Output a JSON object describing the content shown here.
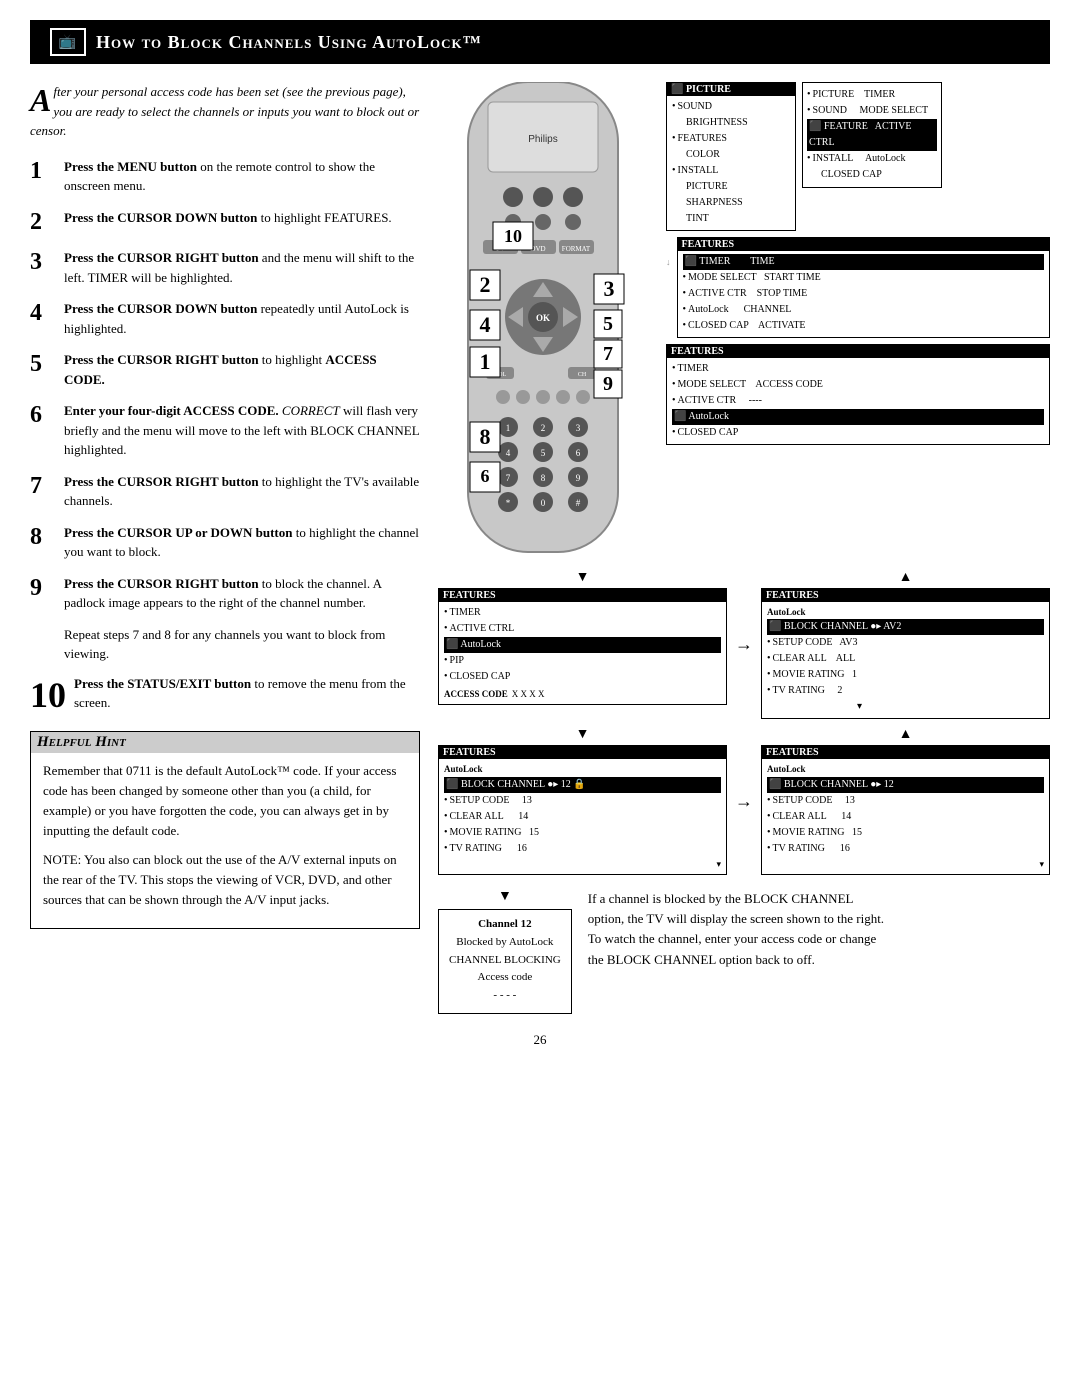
{
  "header": {
    "title": "How to Block Channels Using AutoLock™",
    "icon": "📺"
  },
  "intro": {
    "drop_cap": "A",
    "text": "fter your personal access code has been set (see the previous page), you are ready to select the channels or inputs you want to block out or censor."
  },
  "steps": [
    {
      "num": "1",
      "large": false,
      "html": "<b>Press the MENU button</b> on the remote control to show the onscreen menu."
    },
    {
      "num": "2",
      "large": false,
      "html": "<b>Press the CURSOR DOWN button</b> to highlight FEATURES."
    },
    {
      "num": "3",
      "large": false,
      "html": "<b>Press the CURSOR RIGHT button</b> and the menu will shift to the left. TIMER will be highlighted."
    },
    {
      "num": "4",
      "large": false,
      "html": "<b>Press the CURSOR DOWN button</b> repeatedly until AutoLock is highlighted."
    },
    {
      "num": "5",
      "large": false,
      "html": "<b>Press the CURSOR RIGHT button</b> to highlight <b>ACCESS CODE.</b>"
    },
    {
      "num": "6",
      "large": false,
      "html": "<b>Enter your four-digit ACCESS CODE.</b> <i>CORRECT</i> will flash very briefly and the menu will move to the left with BLOCK CHANNEL highlighted."
    },
    {
      "num": "7",
      "large": false,
      "html": "<b>Press the CURSOR RIGHT button</b> to highlight the TV's available channels."
    },
    {
      "num": "8",
      "large": false,
      "html": "<b>Press the CURSOR UP or DOWN button</b> to highlight the channel you want to block."
    },
    {
      "num": "9",
      "large": false,
      "html": "<b>Press the CURSOR RIGHT button</b> to block the channel. A padlock image appears to the right of the channel number."
    }
  ],
  "repeat_note": "Repeat steps 7 and 8 for any channels you want to block from viewing.",
  "step10": {
    "num": "10",
    "html": "<b>Press the STATUS/EXIT button</b> to remove the menu from the screen."
  },
  "helpful_hint": {
    "title": "Helpful Hint",
    "body1": "Remember that 0711 is the default AutoLock™ code. If your access code has been changed by someone other than you (a child, for example) or you have forgotten the code, you can always get in by inputting the default code.",
    "body2": "NOTE: You also can block out the use of the A/V external inputs on the rear of the TV. This stops the viewing of VCR, DVD, and other sources that can be shown through the A/V input jacks."
  },
  "menu_panels": {
    "panel1_title": "PICTURE",
    "panel1_items": [
      "BRIGHTNESS",
      "COLOR",
      "PICTURE",
      "SHARPNESS",
      "TINT"
    ],
    "panel1_selected": "PICTURE",
    "panel2_title": "",
    "panel2_items": [
      "PICTURE",
      "SOUND",
      "FEATURE",
      "INSTALL"
    ],
    "panel2_right": [
      "TIMER",
      "MODE SELECT",
      "ACTIVE CTRL",
      "AutoLock",
      "CLOSED CAP"
    ],
    "panel2_selected": "FEATURE",
    "panel3_title": "FEATURES",
    "panel3_items": [
      "TIMER",
      "MODE SELECT",
      "ACTIVE CTR",
      "AutoLock",
      "CLOSED CAP"
    ],
    "panel3_right": [
      "TIME",
      "START TIME",
      "STOP TIME",
      "CHANNEL",
      "ACTIVATE"
    ],
    "panel3_selected": "TIMER",
    "panel4_title": "FEATURES",
    "panel4_items": [
      "TIMER",
      "MODE SELECT",
      "ACTIVE CTR",
      "AutoLock",
      "CLOSED CAP"
    ],
    "panel4_access": "ACCESS CODE",
    "panel4_access_val": "----",
    "panel4_selected": "AutoLock",
    "panel5_title": "FEATURES",
    "panel5_items": [
      "TIMER",
      "ACTIVE CTRL",
      "AutoLock",
      "PIP",
      "CLOSED CAP"
    ],
    "panel5_access": "ACCESS CODE",
    "panel5_access_val": "- - - -",
    "panel5_selected": "AutoLock",
    "panel6_title": "FEATURES",
    "panel6_items_left": [
      "TIMER",
      "ACTIVE CTRL",
      "AutoLock",
      "PIP",
      "CLOSED CAP"
    ],
    "panel6_access": "ACCESS CODE",
    "panel6_access_val": "X X X X",
    "panel6_selected": "AutoLock",
    "panel7_title": "FEATURES",
    "panel7_subtitle": "AutoLock",
    "panel7_items": [
      "BLOCK CHANNEL",
      "SETUP CODE",
      "CLEAR ALL",
      "MOVIE RATING",
      "TV RATING"
    ],
    "panel7_right": [
      "AV2",
      "AV3",
      "ALL",
      "1",
      "2"
    ],
    "panel7_selected": "BLOCK CHANNEL",
    "panel8_title": "FEATURES",
    "panel8_subtitle": "AutoLock",
    "panel8_items_left": [
      "BLOCK CHANNEL",
      "SETUP CODE",
      "CLEAR ALL",
      "MOVIE RATING",
      "TV RATING"
    ],
    "panel8_channel": "12",
    "panel8_selected": "BLOCK CHANNEL",
    "panel9_title": "FEATURES",
    "panel9_subtitle": "AutoLock",
    "panel9_items": [
      "BLOCK CHANNEL",
      "SETUP CODE",
      "CLEAR ALL",
      "MOVIE RATING",
      "TV RATING"
    ],
    "panel9_channel": "12",
    "panel9_selected": "BLOCK CHANNEL"
  },
  "channel_blocked": {
    "title": "Channel 12",
    "line1": "Blocked by AutoLock",
    "line2": "CHANNEL BLOCKING",
    "line3": "Access code",
    "line4": "- - - -"
  },
  "bottom_text": "If a channel is blocked by the BLOCK CHANNEL option, the TV will display the screen shown to the right. To watch the channel, enter your access code or change the BLOCK CHANNEL option back to off.",
  "page_number": "26"
}
